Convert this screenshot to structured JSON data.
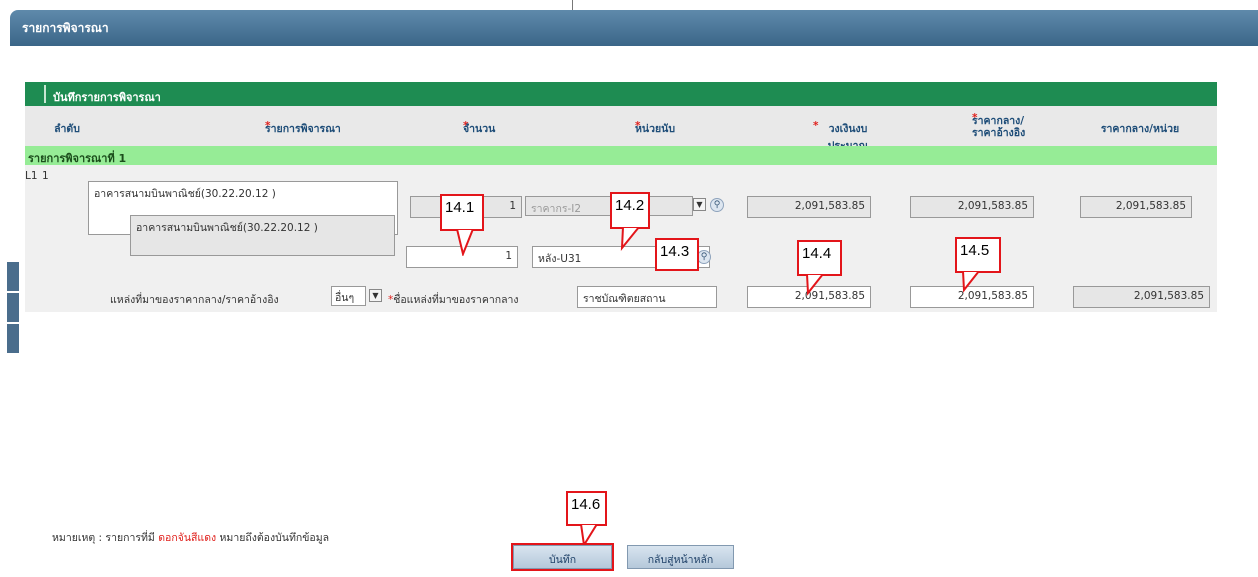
{
  "window": {
    "title": "รายการพิจารณา"
  },
  "grid": {
    "header": "บันทึกรายการพิจารณา",
    "columns": {
      "seq": "ลำดับ",
      "item": "รายการพิจารณา",
      "qty": "จำนวน",
      "unit": "หน่วยนับ",
      "budget": "วงเงินงบประมาณ",
      "ref_price_1": "ราคากลาง/",
      "ref_price_2": "ราคาอ้างอิง",
      "unit_price": "ราคากลาง/หน่วย"
    },
    "required_mark": "*",
    "section": "รายการพิจารณาที่ 1",
    "row": {
      "code": "L1",
      "index": "1",
      "item_text": "อาคารสนามบินพาณิชย์(30.22.20.12 )",
      "qty": "1",
      "unit": "ราคากร-I2",
      "budget": "2,091,583.85",
      "ref_price": "2,091,583.85",
      "unit_price": "2,091,583.85"
    },
    "subrow": {
      "item_text": "อาคารสนามบินพาณิชย์(30.22.20.12 )",
      "qty": "1",
      "unit": "หลัง-U31"
    },
    "source_row": {
      "label": "แหล่งที่มาของราคากลาง/ราคาอ้างอิง",
      "select_value": "อื่นๆ",
      "name_label": "ชื่อแหล่งที่มาของราคากลาง",
      "name_value": "ราชบัณฑิตยสถาน",
      "budget": "2,091,583.85",
      "ref_price": "2,091,583.85",
      "unit_price": "2,091,583.85"
    }
  },
  "callouts": [
    "14.1",
    "14.2",
    "14.3",
    "14.4",
    "14.5",
    "14.6"
  ],
  "footer": {
    "note_prefix": "หมายเหตุ : รายการที่มี",
    "note_highlight": "ดอกจันสีแดง",
    "note_suffix": "หมายถึงต้องบันทึกข้อมูล",
    "save_label": "บันทึก",
    "back_label": "กลับสู่หน้าหลัก"
  },
  "colors": {
    "title_bar": "#3b6688",
    "grid_header": "#1e8c52",
    "section_row": "#96ec96",
    "callout": "#e3151a",
    "required": "#e0201c"
  }
}
